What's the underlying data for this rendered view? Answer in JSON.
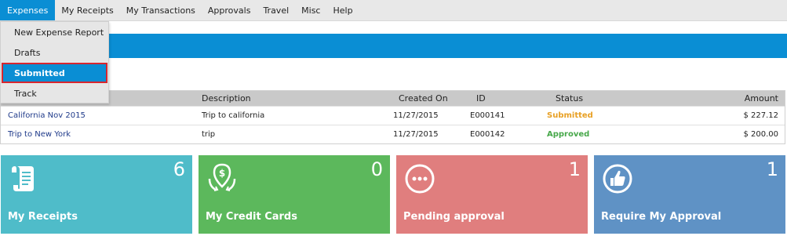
{
  "menu": {
    "items": [
      "Expenses",
      "My Receipts",
      "My Transactions",
      "Approvals",
      "Travel",
      "Misc",
      "Help"
    ]
  },
  "dropdown": {
    "items": [
      "New Expense Report",
      "Drafts",
      "Submitted",
      "Track"
    ],
    "selected": "Submitted"
  },
  "table": {
    "headers": {
      "description": "Description",
      "created_on": "Created On",
      "id": "ID",
      "status": "Status",
      "amount": "Amount"
    },
    "rows": [
      {
        "name": "California Nov 2015",
        "description": "Trip to california",
        "created_on": "11/27/2015",
        "id": "E000141",
        "status": "Submitted",
        "amount": "$ 227.12"
      },
      {
        "name": "Trip to New York",
        "description": "trip",
        "created_on": "11/27/2015",
        "id": "E000142",
        "status": "Approved",
        "amount": "$ 200.00"
      }
    ]
  },
  "tiles": [
    {
      "label": "My Receipts",
      "count": "6",
      "icon": "receipt-icon",
      "color": "#4fbcc9"
    },
    {
      "label": "My Credit Cards",
      "count": "0",
      "icon": "money-pin-icon",
      "color": "#5cb85c"
    },
    {
      "label": "Pending approval",
      "count": "1",
      "icon": "ellipsis-circle-icon",
      "color": "#e07e7e"
    },
    {
      "label": "Require My Approval",
      "count": "1",
      "icon": "thumbs-up-icon",
      "color": "#5f92c5"
    }
  ],
  "colors": {
    "accent": "#0a8ed4",
    "submitted": "#e8a024",
    "approved": "#47a84a",
    "highlight_border": "#d8262e"
  }
}
